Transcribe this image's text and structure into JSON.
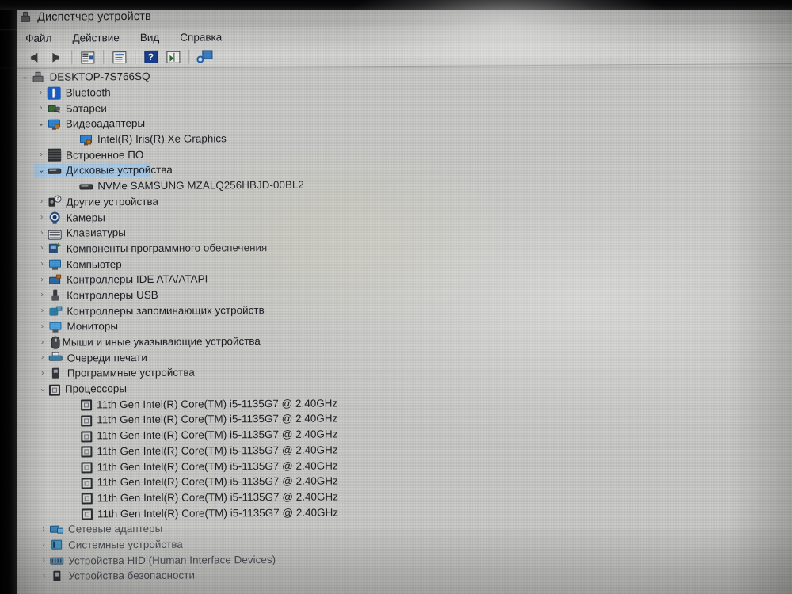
{
  "window": {
    "title": "Диспетчер устройств",
    "title_icon": "device-manager-icon"
  },
  "menu": {
    "items": [
      {
        "label": "Файл",
        "name": "menu-file"
      },
      {
        "label": "Действие",
        "name": "menu-action"
      },
      {
        "label": "Вид",
        "name": "menu-view"
      },
      {
        "label": "Справка",
        "name": "menu-help"
      }
    ]
  },
  "toolbar": {
    "buttons": [
      {
        "icon": "back-arrow-icon",
        "label": "Назад"
      },
      {
        "icon": "forward-arrow-icon",
        "label": "Вперед"
      },
      {
        "icon": "show-hide-tree-icon",
        "label": "Показать дерево"
      },
      {
        "icon": "properties-icon",
        "label": "Свойства"
      },
      {
        "icon": "help-icon",
        "label": "Справка"
      },
      {
        "icon": "update-driver-icon",
        "label": "Обновить драйвер"
      },
      {
        "icon": "scan-hardware-icon",
        "label": "Обновить конфигурацию оборудования"
      }
    ],
    "help_glyph": "?"
  },
  "tree": {
    "selected": "Дисковые устройства",
    "selection_color": "#a9cbe8",
    "chevron_collapsed": "›",
    "chevron_expanded": "⌄",
    "nodes": [
      {
        "label": "DESKTOP-7S766SQ",
        "level": 0,
        "state": "expanded",
        "icon": "computer-node-icon"
      },
      {
        "label": "Bluetooth",
        "level": 1,
        "state": "collapsed",
        "icon": "bluetooth-icon"
      },
      {
        "label": "Батареи",
        "level": 1,
        "state": "collapsed",
        "icon": "battery-icon"
      },
      {
        "label": "Видеоадаптеры",
        "level": 1,
        "state": "expanded",
        "icon": "display-adapter-icon"
      },
      {
        "label": "Intel(R) Iris(R) Xe Graphics",
        "level": 2,
        "state": "leaf",
        "icon": "display-adapter-icon"
      },
      {
        "label": "Встроенное ПО",
        "level": 1,
        "state": "collapsed",
        "icon": "firmware-icon"
      },
      {
        "label": "Дисковые устройства",
        "level": 1,
        "state": "expanded",
        "icon": "disk-drive-icon",
        "selected": true
      },
      {
        "label": "NVMe SAMSUNG MZALQ256HBJD-00BL2",
        "level": 2,
        "state": "leaf",
        "icon": "disk-drive-icon"
      },
      {
        "label": "Другие устройства",
        "level": 1,
        "state": "collapsed",
        "icon": "other-devices-warning-icon"
      },
      {
        "label": "Камеры",
        "level": 1,
        "state": "collapsed",
        "icon": "camera-icon"
      },
      {
        "label": "Клавиатуры",
        "level": 1,
        "state": "collapsed",
        "icon": "keyboard-icon"
      },
      {
        "label": "Компоненты программного обеспечения",
        "level": 1,
        "state": "collapsed",
        "icon": "software-component-icon"
      },
      {
        "label": "Компьютер",
        "level": 1,
        "state": "collapsed",
        "icon": "computer-icon"
      },
      {
        "label": "Контроллеры IDE ATA/ATAPI",
        "level": 1,
        "state": "collapsed",
        "icon": "ide-controller-icon"
      },
      {
        "label": "Контроллеры USB",
        "level": 1,
        "state": "collapsed",
        "icon": "usb-controller-icon"
      },
      {
        "label": "Контроллеры запоминающих устройств",
        "level": 1,
        "state": "collapsed",
        "icon": "storage-controller-icon"
      },
      {
        "label": "Мониторы",
        "level": 1,
        "state": "collapsed",
        "icon": "monitor-icon"
      },
      {
        "label": "Мыши и иные указывающие устройства",
        "level": 1,
        "state": "collapsed",
        "icon": "mouse-icon"
      },
      {
        "label": "Очереди печати",
        "level": 1,
        "state": "collapsed",
        "icon": "print-queue-icon"
      },
      {
        "label": "Программные устройства",
        "level": 1,
        "state": "collapsed",
        "icon": "software-device-icon"
      },
      {
        "label": "Процессоры",
        "level": 1,
        "state": "expanded",
        "icon": "processor-icon"
      },
      {
        "label": "11th Gen Intel(R) Core(TM) i5-1135G7 @ 2.40GHz",
        "level": 2,
        "state": "leaf",
        "icon": "processor-icon"
      },
      {
        "label": "11th Gen Intel(R) Core(TM) i5-1135G7 @ 2.40GHz",
        "level": 2,
        "state": "leaf",
        "icon": "processor-icon"
      },
      {
        "label": "11th Gen Intel(R) Core(TM) i5-1135G7 @ 2.40GHz",
        "level": 2,
        "state": "leaf",
        "icon": "processor-icon"
      },
      {
        "label": "11th Gen Intel(R) Core(TM) i5-1135G7 @ 2.40GHz",
        "level": 2,
        "state": "leaf",
        "icon": "processor-icon"
      },
      {
        "label": "11th Gen Intel(R) Core(TM) i5-1135G7 @ 2.40GHz",
        "level": 2,
        "state": "leaf",
        "icon": "processor-icon"
      },
      {
        "label": "11th Gen Intel(R) Core(TM) i5-1135G7 @ 2.40GHz",
        "level": 2,
        "state": "leaf",
        "icon": "processor-icon"
      },
      {
        "label": "11th Gen Intel(R) Core(TM) i5-1135G7 @ 2.40GHz",
        "level": 2,
        "state": "leaf",
        "icon": "processor-icon"
      },
      {
        "label": "11th Gen Intel(R) Core(TM) i5-1135G7 @ 2.40GHz",
        "level": 2,
        "state": "leaf",
        "icon": "processor-icon"
      },
      {
        "label": "Сетевые адаптеры",
        "level": 1,
        "state": "collapsed",
        "icon": "network-adapter-icon"
      },
      {
        "label": "Системные устройства",
        "level": 1,
        "state": "collapsed",
        "icon": "system-device-icon"
      },
      {
        "label": "Устройства HID (Human Interface Devices)",
        "level": 1,
        "state": "collapsed",
        "icon": "hid-device-icon"
      },
      {
        "label": "Устройства безопасности",
        "level": 1,
        "state": "collapsed",
        "icon": "security-device-icon"
      }
    ]
  }
}
